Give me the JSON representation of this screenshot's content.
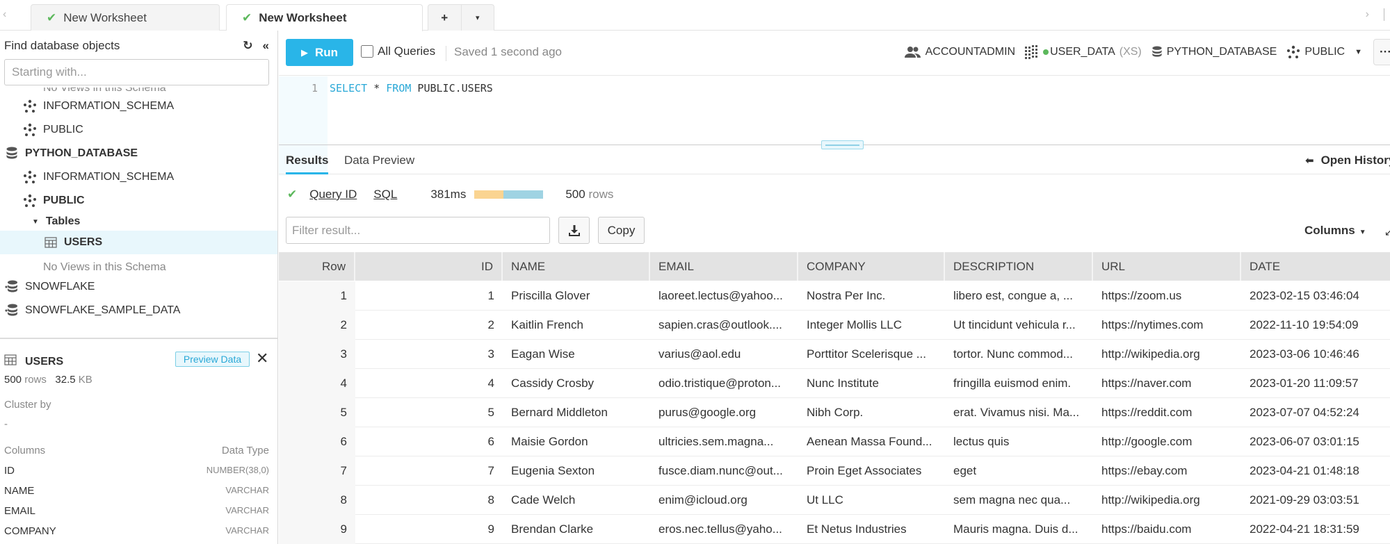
{
  "tabs": {
    "items": [
      {
        "label": "New Worksheet",
        "active": false
      },
      {
        "label": "New Worksheet",
        "active": true
      }
    ],
    "add_label": "+",
    "menu_label": "▾",
    "nav_left": "‹",
    "nav_right": "›"
  },
  "sidebar": {
    "title": "Find database objects",
    "search_placeholder": "Starting with...",
    "tree": [
      {
        "label": "No Views in this Schema",
        "type": "note",
        "level": 2,
        "clipped": true
      },
      {
        "label": "INFORMATION_SCHEMA",
        "type": "schema",
        "level": 1
      },
      {
        "label": "PUBLIC",
        "type": "schema",
        "level": 1
      },
      {
        "label": "PYTHON_DATABASE",
        "type": "database",
        "level": 0,
        "bold": true
      },
      {
        "label": "INFORMATION_SCHEMA",
        "type": "schema",
        "level": 1
      },
      {
        "label": "PUBLIC",
        "type": "schema",
        "level": 1,
        "bold": true
      },
      {
        "label": "Tables",
        "type": "folder",
        "level": 2,
        "bold": true,
        "expanded": true
      },
      {
        "label": "USERS",
        "type": "table",
        "level": 3,
        "bold": true,
        "selected": true
      },
      {
        "label": "No Views in this Schema",
        "type": "note",
        "level": 2
      },
      {
        "label": "SNOWFLAKE",
        "type": "shared-database",
        "level": 0
      },
      {
        "label": "SNOWFLAKE_SAMPLE_DATA",
        "type": "shared-database",
        "level": 0
      }
    ],
    "details": {
      "title": "USERS",
      "preview_button": "Preview Data",
      "rows_value": "500",
      "rows_unit": "rows",
      "size_value": "32.5",
      "size_unit": "KB",
      "cluster_label": "Cluster by",
      "cluster_value": "-",
      "columns_header": "Columns",
      "type_header": "Data Type",
      "columns": [
        {
          "name": "ID",
          "type": "NUMBER(38,0)"
        },
        {
          "name": "NAME",
          "type": "VARCHAR"
        },
        {
          "name": "EMAIL",
          "type": "VARCHAR"
        },
        {
          "name": "COMPANY",
          "type": "VARCHAR"
        }
      ]
    }
  },
  "toolbar": {
    "run_label": "Run",
    "all_queries_label": "All Queries",
    "all_queries_checked": false,
    "saved_status": "Saved 1 second ago",
    "role": "ACCOUNTADMIN",
    "warehouse": "USER_DATA",
    "warehouse_size": "(XS)",
    "warehouse_status_color": "#5cb85c",
    "database": "PYTHON_DATABASE",
    "schema": "PUBLIC",
    "more_label": "···"
  },
  "editor": {
    "line_number": "1",
    "kw1": "SELECT",
    "mid": " * ",
    "kw2": "FROM",
    "rest": " PUBLIC.USERS"
  },
  "results": {
    "tabs": [
      "Results",
      "Data Preview"
    ],
    "active_tab": "Results",
    "open_history": "Open History",
    "query_id_label": "Query ID",
    "sql_label": "SQL",
    "duration": "381ms",
    "duration_split": {
      "compile_fraction": 0.42,
      "execute_fraction": 0.58
    },
    "row_count": "500",
    "row_unit": "rows",
    "filter_placeholder": "Filter result...",
    "copy_label": "Copy",
    "columns_label": "Columns",
    "columns_header": [
      "Row",
      "ID",
      "NAME",
      "EMAIL",
      "COMPANY",
      "DESCRIPTION",
      "URL",
      "DATE"
    ],
    "rows": [
      [
        "1",
        "1",
        "Priscilla Glover",
        "laoreet.lectus@yahoo...",
        "Nostra Per Inc.",
        "libero est, congue a, ...",
        "https://zoom.us",
        "2023-02-15 03:46:04"
      ],
      [
        "2",
        "2",
        "Kaitlin French",
        "sapien.cras@outlook....",
        "Integer Mollis LLC",
        "Ut tincidunt vehicula r...",
        "https://nytimes.com",
        "2022-11-10 19:54:09"
      ],
      [
        "3",
        "3",
        "Eagan Wise",
        "varius@aol.edu",
        "Porttitor Scelerisque ...",
        "tortor. Nunc commod...",
        "http://wikipedia.org",
        "2023-03-06 10:46:46"
      ],
      [
        "4",
        "4",
        "Cassidy Crosby",
        "odio.tristique@proton...",
        "Nunc Institute",
        "fringilla euismod enim.",
        "https://naver.com",
        "2023-01-20 11:09:57"
      ],
      [
        "5",
        "5",
        "Bernard Middleton",
        "purus@google.org",
        "Nibh Corp.",
        "erat. Vivamus nisi. Ma...",
        "https://reddit.com",
        "2023-07-07 04:52:24"
      ],
      [
        "6",
        "6",
        "Maisie Gordon",
        "ultricies.sem.magna...",
        "Aenean Massa Found...",
        "lectus quis",
        "http://google.com",
        "2023-06-07 03:01:15"
      ],
      [
        "7",
        "7",
        "Eugenia Sexton",
        "fusce.diam.nunc@out...",
        "Proin Eget Associates",
        "eget",
        "https://ebay.com",
        "2023-04-21 01:48:18"
      ],
      [
        "8",
        "8",
        "Cade Welch",
        "enim@icloud.org",
        "Ut LLC",
        "sem magna nec qua...",
        "http://wikipedia.org",
        "2021-09-29 03:03:51"
      ],
      [
        "9",
        "9",
        "Brendan Clarke",
        "eros.nec.tellus@yaho...",
        "Et Netus Industries",
        "Mauris magna. Duis d...",
        "https://baidu.com",
        "2022-04-21 18:31:59"
      ]
    ]
  },
  "colors": {
    "accent": "#29b5e8",
    "success": "#5cb85c",
    "selected_bg": "#e8f7fc"
  }
}
